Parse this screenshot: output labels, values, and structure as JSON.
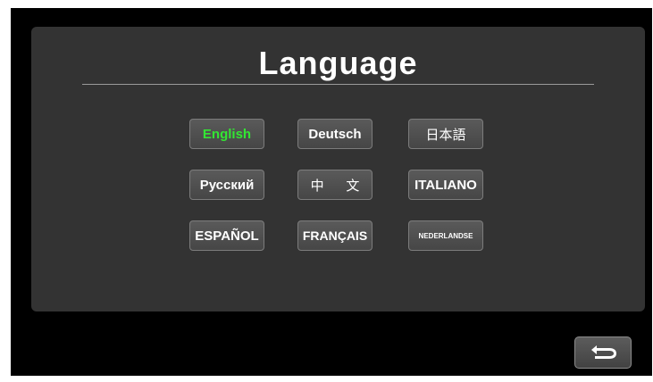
{
  "title": "Language",
  "languages": [
    {
      "label": "English"
    },
    {
      "label": "Deutsch"
    },
    {
      "label": "日本語"
    },
    {
      "label": "Русский"
    },
    {
      "label": "中 文"
    },
    {
      "label": "ITALIANO"
    },
    {
      "label": "ESPAÑOL"
    },
    {
      "label": "FRANÇAIS"
    },
    {
      "label": "NEDERLANDSE"
    }
  ],
  "selected_language": "English",
  "back_button": {
    "icon": "return-arrow-icon"
  },
  "colors": {
    "background": "#000000",
    "panel": "#333333",
    "button": "#4d4d4d",
    "selected_text": "#33e633",
    "text": "#ffffff"
  }
}
